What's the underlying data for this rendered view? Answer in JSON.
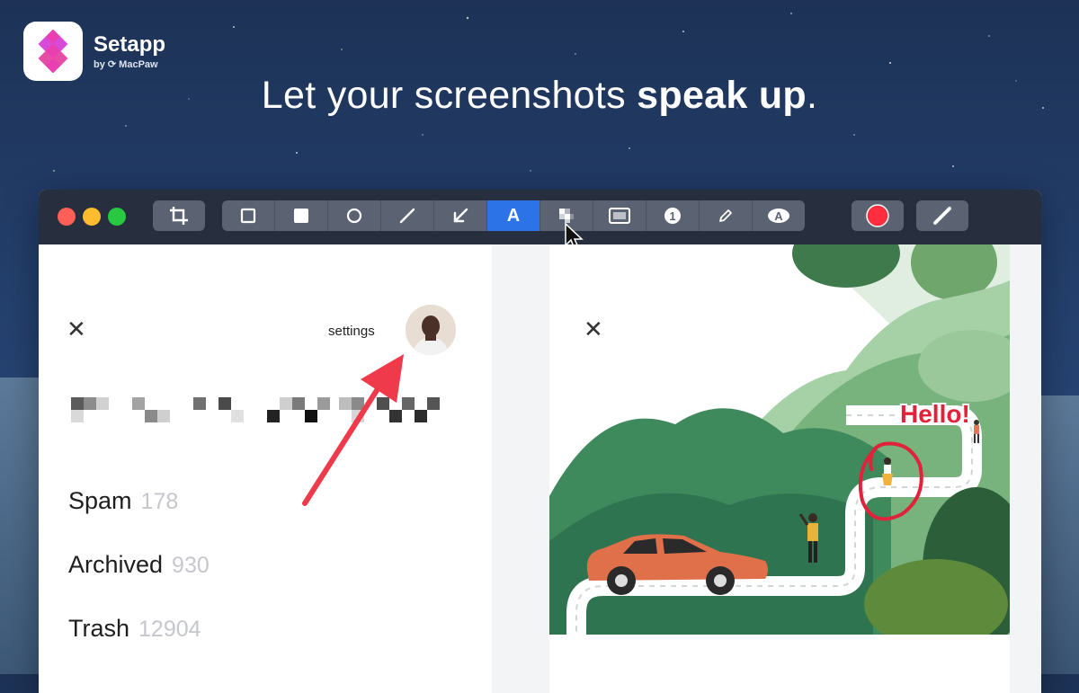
{
  "brand": {
    "name": "Setapp",
    "sub": "by ⟳ MacPaw"
  },
  "headline": {
    "normal_before": "Let your screenshots ",
    "bold": "speak up",
    "normal_after": "."
  },
  "toolbar": {
    "tools": [
      {
        "name": "rectangle-icon",
        "glyph": "□"
      },
      {
        "name": "filled-rectangle-icon",
        "glyph": "■"
      },
      {
        "name": "ellipse-icon",
        "glyph": "○"
      },
      {
        "name": "line-icon",
        "glyph": "╱"
      },
      {
        "name": "arrow-icon",
        "glyph": "↙"
      },
      {
        "name": "text-icon",
        "glyph": "A",
        "active": true
      },
      {
        "name": "pixelate-icon",
        "glyph": "▦"
      },
      {
        "name": "highlight-icon",
        "glyph": "▭"
      },
      {
        "name": "counter-icon",
        "glyph": "❶"
      },
      {
        "name": "pencil-icon",
        "glyph": "✎"
      },
      {
        "name": "blur-text-icon",
        "glyph": "A"
      }
    ],
    "selected_color": "#ff2d3d",
    "accent": "#2d73e8"
  },
  "left_pane": {
    "settings_label": "settings",
    "menu": [
      {
        "label": "Spam",
        "count": "178"
      },
      {
        "label": "Archived",
        "count": "930"
      },
      {
        "label": "Trash",
        "count": "12904"
      }
    ],
    "annotation_arrow_color": "#ee3a4a"
  },
  "right_pane": {
    "hello_label": "Hello!",
    "annotation_color": "#e0223a"
  }
}
